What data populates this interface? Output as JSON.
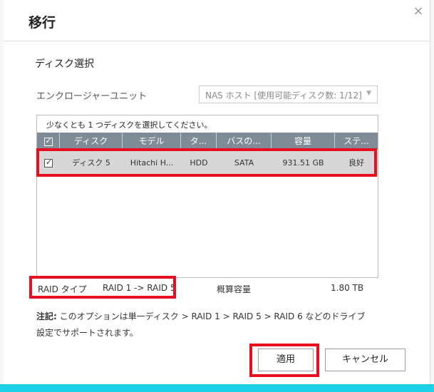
{
  "dialog": {
    "title": "移行",
    "close_icon": "close-icon"
  },
  "section": {
    "title": "ディスク選択"
  },
  "enclosure": {
    "label": "エンクロージャーユニット",
    "selected": "NAS ホスト [使用可能ディスク数: 1/12]"
  },
  "disk_table": {
    "caption": "少なくとも 1 つディスクを選択してください。",
    "headers": [
      "ディスク",
      "モデル",
      "タ...",
      "バスの...",
      "容量",
      "ステ..."
    ],
    "rows": [
      {
        "checked": true,
        "disk": "ディスク 5",
        "model": "Hitachi H...",
        "type": "HDD",
        "bus": "SATA",
        "capacity": "931.51 GB",
        "status": "良好"
      }
    ]
  },
  "summary": {
    "raid_label": "RAID タイプ",
    "raid_value": "RAID 1 -> RAID 5",
    "capacity_label": "概算容量",
    "capacity_value": "1.80 TB"
  },
  "note": {
    "prefix": "注記:",
    "text": " このオプションは単一ディスク > RAID 1 > RAID 5 > RAID 6 などのドライブ設定でサポートされます。"
  },
  "buttons": {
    "apply": "適用",
    "cancel": "キャンセル"
  },
  "colors": {
    "highlight": "#e8101e",
    "table_header": "#7f8c98",
    "selected_row": "#d7d7d7",
    "accent_bar": "#1fd1e6"
  }
}
